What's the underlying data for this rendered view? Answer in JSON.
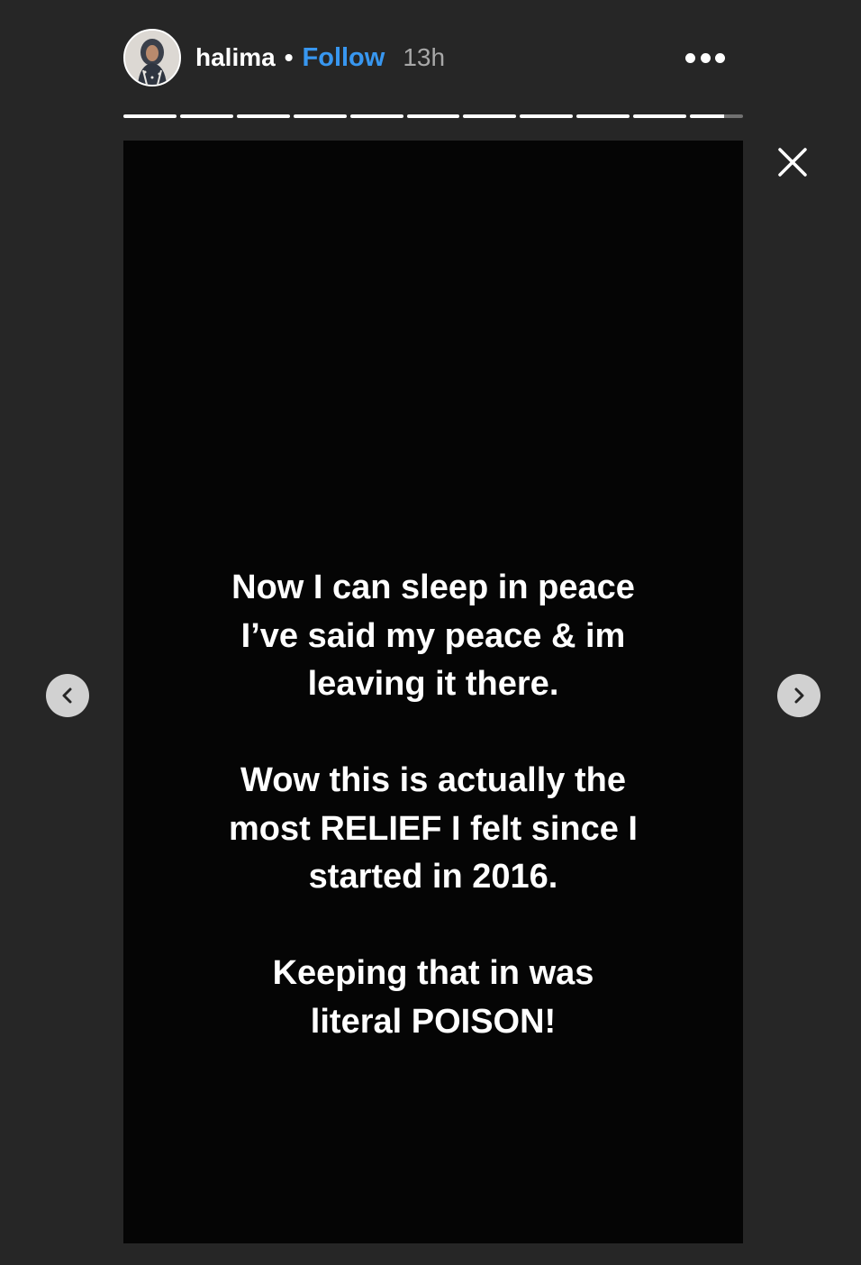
{
  "header": {
    "username": "halima",
    "separator": "•",
    "follow_label": "Follow",
    "time_ago": "13h",
    "more_icon": "more-horizontal-icon"
  },
  "progress": {
    "segment_count": 11,
    "segments_fill": [
      1,
      1,
      1,
      1,
      1,
      1,
      1,
      1,
      1,
      1,
      0.65
    ]
  },
  "story": {
    "paragraphs": [
      "Now I can sleep in peace\nI’ve said my peace & im\nleaving it there.",
      "Wow this is actually the\nmost RELIEF I felt since I\nstarted in 2016.",
      "Keeping that in was\nliteral POISON!"
    ]
  },
  "controls": {
    "close_icon": "close-icon",
    "prev_icon": "chevron-left-icon",
    "next_icon": "chevron-right-icon"
  },
  "colors": {
    "page_background": "#262626",
    "story_background": "#050505",
    "follow_blue": "#3897f0",
    "time_gray": "#a8a8a8",
    "nav_button": "#d1d1d1"
  }
}
